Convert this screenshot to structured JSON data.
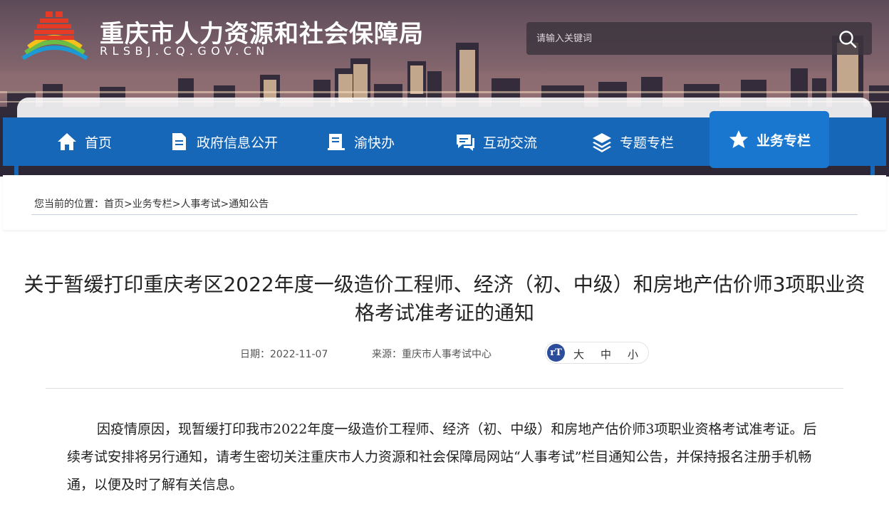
{
  "header": {
    "site_title": "重庆市人力资源和社会保障局",
    "site_domain": "RLSBJ.CQ.GOV.CN",
    "search_placeholder": "请输入关键词",
    "logo_icon": "rensheju-logo-icon",
    "search_icon": "search-icon"
  },
  "nav": {
    "items": [
      {
        "label": "首页",
        "icon": "home-icon"
      },
      {
        "label": "政府信息公开",
        "icon": "document-icon"
      },
      {
        "label": "渝快办",
        "icon": "clipboard-icon"
      },
      {
        "label": "互动交流",
        "icon": "chat-icon"
      },
      {
        "label": "专题专栏",
        "icon": "layers-icon"
      },
      {
        "label": "业务专栏",
        "icon": "star-icon"
      }
    ],
    "active_index": 5
  },
  "breadcrumb": {
    "prefix": "您当前的位置：",
    "items": [
      "首页",
      "业务专栏",
      "人事考试",
      "通知公告"
    ],
    "separator": ">"
  },
  "article": {
    "title": "关于暂缓打印重庆考区2022年度一级造价工程师、经济（初、中级）和房地产估价师3项职业资格考试准考证的通知",
    "date_label": "日期：",
    "date": "2022-11-07",
    "source_label": "来源：",
    "source": "重庆市人事考试中心",
    "font_icon_text": "rT",
    "font_sizes": [
      "大",
      "中",
      "小"
    ],
    "body": "因疫情原因，现暂缓打印我市2022年度一级造价工程师、经济（初、中级）和房地产估价师3项职业资格考试准考证。后续考试安排将另行通知，请考生密切关注重庆市人力资源和社会保障局网站“人事考试”栏目通知公告，并保持报名注册手机畅通，以便及时了解有关信息。"
  },
  "colors": {
    "nav_blue": "#1767b9",
    "nav_active": "#1a77cf",
    "font_icon": "#2b4d9c"
  }
}
